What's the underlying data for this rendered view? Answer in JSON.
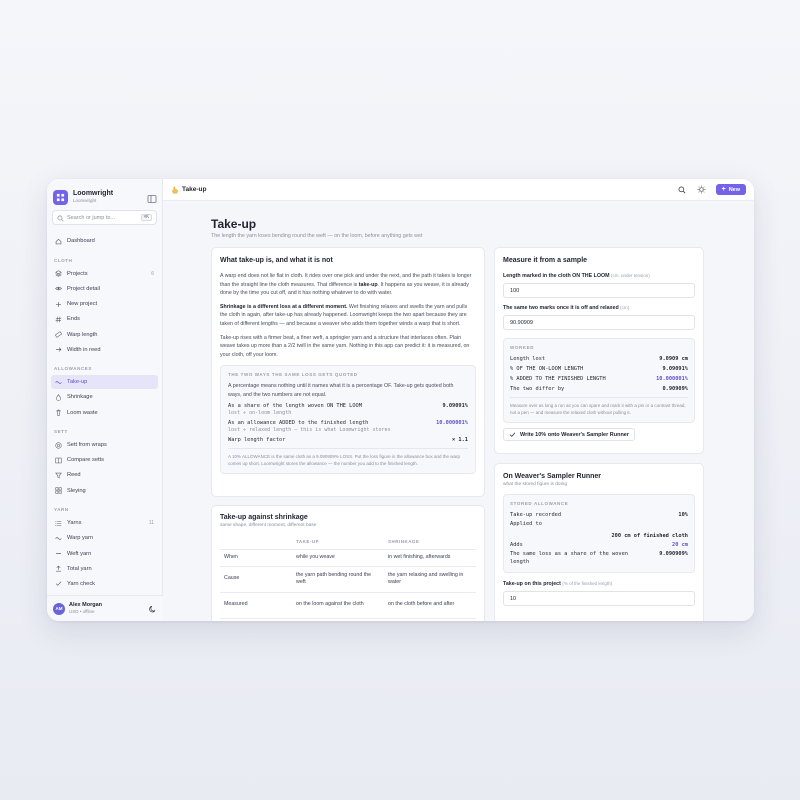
{
  "app": {
    "name": "Loomwright",
    "sub": "Loomwright"
  },
  "search": {
    "placeholder": "Search or jump to...",
    "shortcut": "⌘K"
  },
  "nav": {
    "dashboard": "Dashboard",
    "sections": {
      "cloth": "CLOTH",
      "allowances": "ALLOWANCES",
      "sett": "SETT",
      "yarn": "YARN"
    },
    "cloth_items": [
      {
        "label": "Projects",
        "count": "6",
        "icon": "layers-icon"
      },
      {
        "label": "Project detail",
        "count": "",
        "icon": "eye-icon"
      },
      {
        "label": "New project",
        "count": "",
        "icon": "plus-icon"
      },
      {
        "label": "Ends",
        "count": "",
        "icon": "hash-icon"
      },
      {
        "label": "Warp length",
        "count": "",
        "icon": "ruler-icon"
      },
      {
        "label": "Width in reed",
        "count": "",
        "icon": "arrow-right-icon"
      }
    ],
    "allowance_items": [
      {
        "label": "Take-up",
        "active": true,
        "icon": "wave-icon"
      },
      {
        "label": "Shrinkage",
        "active": false,
        "icon": "drop-icon"
      },
      {
        "label": "Loom waste",
        "active": false,
        "icon": "trash-icon"
      }
    ],
    "sett_items": [
      {
        "label": "Sett from wraps",
        "icon": "target-icon"
      },
      {
        "label": "Compare setts",
        "icon": "columns-icon"
      },
      {
        "label": "Reed",
        "icon": "filter-icon"
      },
      {
        "label": "Sleying",
        "icon": "grid-icon"
      }
    ],
    "yarn_items": [
      {
        "label": "Yarns",
        "count": "11",
        "icon": "list-icon"
      },
      {
        "label": "Warp yarn",
        "count": "",
        "icon": "wave-icon"
      },
      {
        "label": "Weft yarn",
        "count": "",
        "icon": "minus-icon"
      },
      {
        "label": "Total yarn",
        "count": "",
        "icon": "upload-icon"
      },
      {
        "label": "Yarn check",
        "count": "",
        "icon": "check-icon"
      }
    ]
  },
  "user": {
    "initials": "AM",
    "name": "Alex Morgan",
    "sub": "USD • offline"
  },
  "topbar": {
    "title": "Take-up",
    "new_label": "New"
  },
  "page": {
    "title": "Take-up",
    "subtitle": "The length the yarn loses bending round the weft — on the loom, before anything gets wet"
  },
  "explain": {
    "title": "What take-up is, and what it is not",
    "p1_a": "A warp end does not lie flat in cloth. It rides over one pick and under the next, and the path it takes is longer than the straight line the cloth measures. That difference is ",
    "p1_b": "take-up",
    "p1_c": ". It happens as you weave, it is already done by the time you cut off, and it has nothing whatever to do with water.",
    "p2_a": "Shrinkage is a different loss at a different moment.",
    "p2_b": " Wet finishing relaxes and swells the yarn and pulls the cloth in again, after take-up has already happened. Loomwright keeps the two apart because they are taken of different lengths — and because a weaver who adds them together winds a warp that is short.",
    "p3": "Take-up rises with a firmer beat, a finer weft, a springier yarn and a structure that interlaces often. Plain weave takes up more than a 2/2 twill in the same yarn. Nothing in this app can predict it: it is measured, on your cloth, off your loom.",
    "box": {
      "title": "THE TWO WAYS THE SAME LOSS GETS QUOTED",
      "intro": "A percentage means nothing until it names what it is a percentage OF. Take-up gets quoted both ways, and the two numbers are not equal.",
      "r1_label": "As a share of the length woven ON THE LOOM",
      "r1_value": "9.09091%",
      "r1_formula": "lost ÷ on-loom length",
      "r2_label": "As an allowance ADDED to the finished length",
      "r2_value": "10.000001%",
      "r2_formula": "lost ÷ relaxed length — this is what Loomwright stores",
      "r3_label": "Warp length factor",
      "r3_value": "× 1.1",
      "note": "A 10% ALLOWANCE is the same cloth as a 9.090909% LOSS. Put the loss figure in the allowance box and the warp comes up short. Loomwright stores the allowance — the number you add to the finished length."
    }
  },
  "compare": {
    "title": "Take-up against shrinkage",
    "subtitle": "same shape, different moment, different base",
    "headers": [
      "",
      "TAKE-UP",
      "SHRINKAGE"
    ],
    "rows": [
      [
        "When",
        "while you weave",
        "in wet finishing, afterwards"
      ],
      [
        "Cause",
        "the yarn path bending round the weft",
        "the yarn relaxing and swelling in water"
      ],
      [
        "Measured",
        "on the loom against the cloth",
        "on the cloth before and after"
      ]
    ]
  },
  "measure": {
    "title": "Measure it from a sample",
    "f1_label": "Length marked in the cloth ON THE LOOM",
    "f1_hint": "(cm, under tension)",
    "f1_value": "100",
    "f2_label": "The same two marks once it is off and relaxed",
    "f2_hint": "(cm)",
    "f2_value": "90.90909",
    "worked": {
      "title": "WORKED",
      "r1_label": "Length lost",
      "r1_value": "9.0909 cm",
      "r2_label": "% OF THE ON-LOOM LENGTH",
      "r2_value": "9.09091%",
      "r3_label": "% ADDED TO THE FINISHED LENGTH",
      "r3_value": "10.000001%",
      "r4_label": "The two differ by",
      "r4_value": "0.90909%",
      "note": "Measure over as long a run as you can spare and mark it with a pin or a contrast thread, not a pen — and measure the relaxed cloth without pulling it."
    },
    "write_label": "Write 10% onto Weaver's Sampler Runner"
  },
  "project": {
    "title": "On Weaver's Sampler Runner",
    "subtitle": "what the stored figure is doing",
    "box": {
      "title": "STORED ALLOWANCE",
      "r1_label": "Take-up recorded",
      "r1_value": "10%",
      "r2_label": "Applied to",
      "r2_value": "200 cm of finished cloth",
      "r3_label": "Adds",
      "r3_value": "20 cm",
      "r4_label": "The same loss as a share of the woven length",
      "r4_value": "9.090909%"
    },
    "field_label": "Take-up on this project",
    "field_hint": "(% of the finished length)",
    "field_value": "10"
  },
  "colors": {
    "accent": "#7263e8",
    "accent_text": "#5b4fd0"
  }
}
